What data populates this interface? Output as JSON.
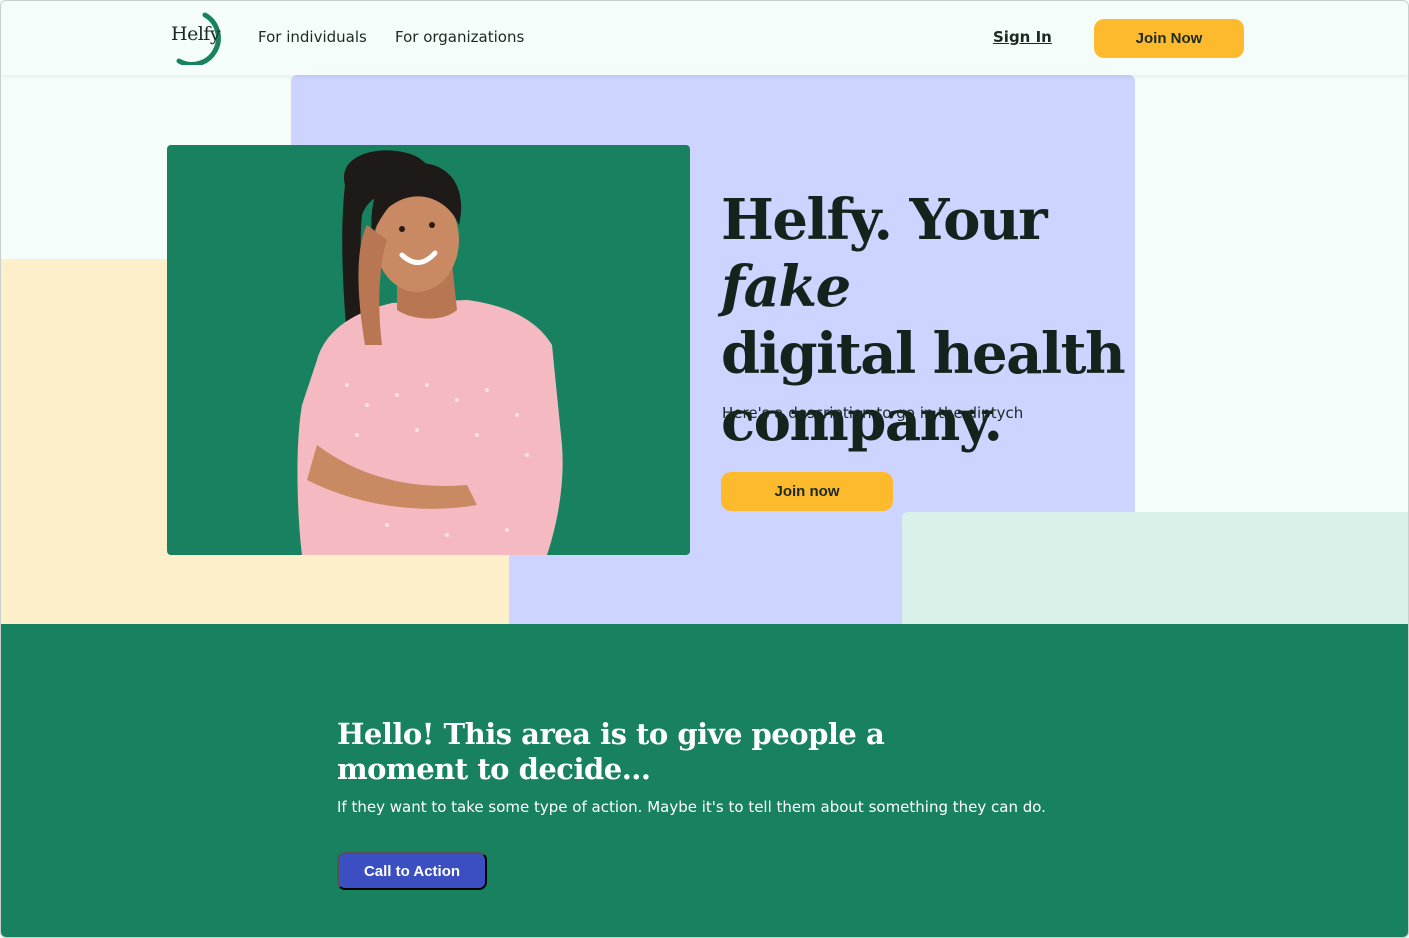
{
  "header": {
    "logo_text": "Helfy",
    "nav": [
      "For individuals",
      "For organizations"
    ],
    "sign_in": "Sign In",
    "join_now": "Join Now"
  },
  "hero": {
    "title_part1": "Helfy. Your ",
    "title_em": "fake",
    "title_part2": "digital health company.",
    "description": "Here's a description to go in the diptych",
    "cta": "Join now"
  },
  "band": {
    "title": "Hello! This area is to give people a moment to decide...",
    "text": "If they want to take some type of action. Maybe it's to tell them about something they can do.",
    "cta": "Call to Action"
  },
  "colors": {
    "accent_yellow": "#fdba2d",
    "brand_green": "#188260",
    "lavender": "#ccd4ff",
    "peach": "#feefcb",
    "mint": "#d9f1e8",
    "cta_blue": "#3b4fc2"
  }
}
